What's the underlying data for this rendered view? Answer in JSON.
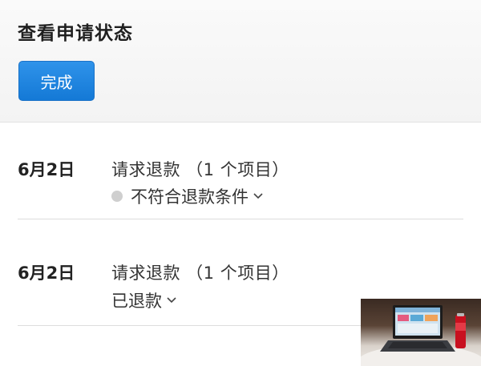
{
  "header": {
    "title": "查看申请状态",
    "done_label": "完成"
  },
  "requests": [
    {
      "date": "6月2日",
      "title": "请求退款 （1 个项目）",
      "status": "不符合退款条件"
    },
    {
      "date": "6月2日",
      "title": "请求退款 （1 个项目）",
      "status": "已退款"
    }
  ],
  "colors": {
    "accent": "#1a7fe0",
    "status_dot": "#cfcfcf"
  },
  "icons": {
    "status_dot": "gray-dot-icon",
    "expand": "chevron-down-icon"
  }
}
